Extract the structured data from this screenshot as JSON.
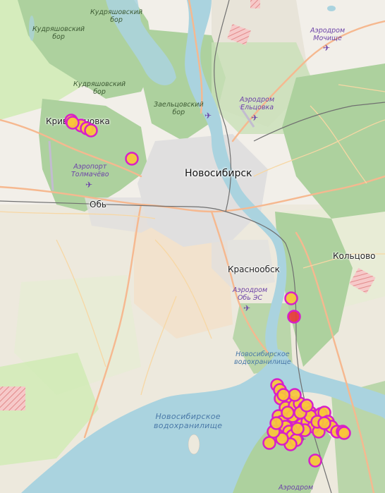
{
  "colors": {
    "background": "#f2efe9",
    "water": "#aad3df",
    "forest": "#add19e",
    "forest_dark": "#98c08a",
    "meadow": "#cdebb0",
    "urban": "#e0dfdf",
    "residential": "#f5dcc0",
    "road_major": "#f6b88f",
    "road_minor": "#f7d7a4",
    "railway": "#707070",
    "military": "#f3b6b6",
    "marker_fill": "#f9c53a",
    "marker_stroke": "#d81fc8",
    "marker_fill_highlight": "#e83a3a"
  },
  "places": {
    "novosibirsk": "Новосибирск",
    "krivodanovka": "Криводановка",
    "ob": "Обь",
    "krasnoobsk": "Краснообск",
    "koltsovo": "Кольцово"
  },
  "forests": {
    "kudryash1": [
      "Кудряшовский",
      "бор"
    ],
    "kudryash2": [
      "Кудряшовский",
      "бор"
    ],
    "kudryash3": [
      "Кудряшовский",
      "бор"
    ],
    "zaeltsov": [
      "Заельцовский",
      "бор"
    ]
  },
  "airports": {
    "mochische": [
      "Аэродром",
      "Мочище"
    ],
    "eltsovka": [
      "Аэродром",
      "Ельцовка"
    ],
    "tolmachevo": [
      "Аэропорт",
      "Толмачёво"
    ],
    "ob_es": [
      "Аэродром",
      "Обь ЭС"
    ],
    "bottom": [
      "Аэродром"
    ]
  },
  "water": {
    "reservoir_small": [
      "Новосибирское",
      "водохранилище"
    ],
    "reservoir_big": [
      "Новосибирское",
      "водохранилище"
    ]
  },
  "icons": {
    "plane": "airplane-icon"
  },
  "markers": [
    {
      "id": "krivodanovka-1"
    },
    {
      "id": "krivodanovka-2"
    },
    {
      "id": "krivodanovka-3"
    },
    {
      "id": "krivodanovka-4"
    },
    {
      "id": "krivodanovka-5"
    },
    {
      "id": "tolmachevo"
    },
    {
      "id": "ob-es-1"
    },
    {
      "id": "ob-es-2",
      "highlight": true
    },
    {
      "id": "reservoir-cluster"
    }
  ]
}
